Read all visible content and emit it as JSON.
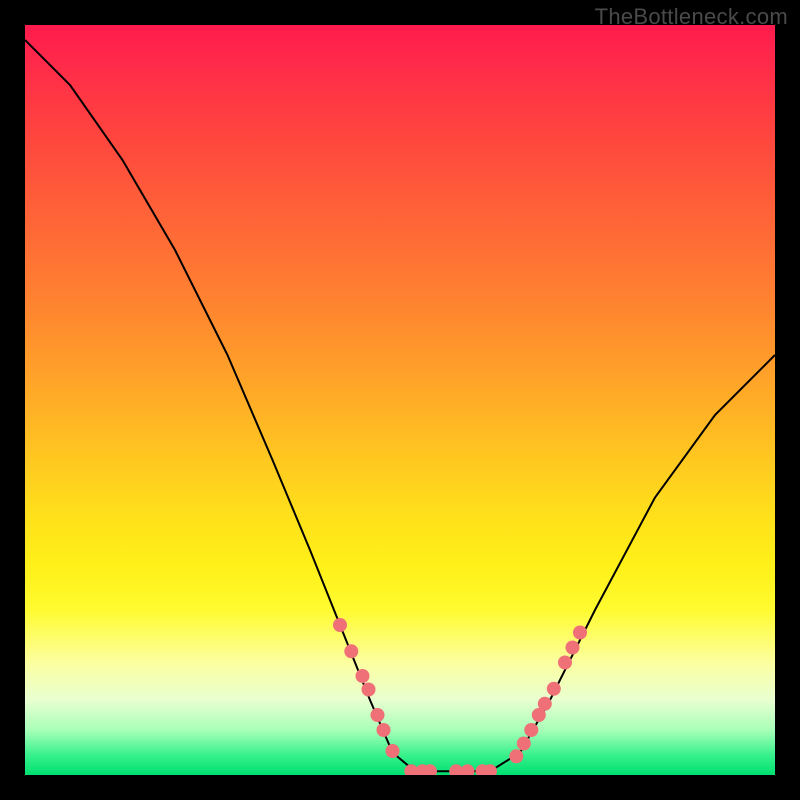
{
  "watermark": "TheBottleneck.com",
  "chart_data": {
    "type": "line",
    "title": "",
    "xlabel": "",
    "ylabel": "",
    "xlim": [
      0,
      100
    ],
    "ylim": [
      0,
      100
    ],
    "curve": [
      {
        "x": 0,
        "y": 98
      },
      {
        "x": 6,
        "y": 92
      },
      {
        "x": 13,
        "y": 82
      },
      {
        "x": 20,
        "y": 70
      },
      {
        "x": 27,
        "y": 56
      },
      {
        "x": 33,
        "y": 42
      },
      {
        "x": 38,
        "y": 30
      },
      {
        "x": 42,
        "y": 20
      },
      {
        "x": 46,
        "y": 10
      },
      {
        "x": 49,
        "y": 3
      },
      {
        "x": 52,
        "y": 0.5
      },
      {
        "x": 58,
        "y": 0.5
      },
      {
        "x": 62,
        "y": 0.5
      },
      {
        "x": 66,
        "y": 3
      },
      {
        "x": 70,
        "y": 10
      },
      {
        "x": 76,
        "y": 22
      },
      {
        "x": 84,
        "y": 37
      },
      {
        "x": 92,
        "y": 48
      },
      {
        "x": 100,
        "y": 56
      }
    ],
    "markers_left": [
      {
        "x": 42.0,
        "y": 20.0
      },
      {
        "x": 43.5,
        "y": 16.5
      },
      {
        "x": 45.0,
        "y": 13.2
      },
      {
        "x": 45.8,
        "y": 11.4
      },
      {
        "x": 47.0,
        "y": 8.0
      },
      {
        "x": 47.8,
        "y": 6.0
      },
      {
        "x": 49.0,
        "y": 3.2
      }
    ],
    "markers_bottom": [
      {
        "x": 51.5,
        "y": 0.5
      },
      {
        "x": 53.0,
        "y": 0.5
      },
      {
        "x": 54.0,
        "y": 0.5
      },
      {
        "x": 57.5,
        "y": 0.5
      },
      {
        "x": 59.0,
        "y": 0.5
      },
      {
        "x": 61.0,
        "y": 0.5
      },
      {
        "x": 62.0,
        "y": 0.5
      }
    ],
    "markers_right": [
      {
        "x": 65.5,
        "y": 2.5
      },
      {
        "x": 66.5,
        "y": 4.2
      },
      {
        "x": 67.5,
        "y": 6.0
      },
      {
        "x": 68.5,
        "y": 8.0
      },
      {
        "x": 69.3,
        "y": 9.5
      },
      {
        "x": 70.5,
        "y": 11.5
      },
      {
        "x": 72.0,
        "y": 15.0
      },
      {
        "x": 73.0,
        "y": 17.0
      },
      {
        "x": 74.0,
        "y": 19.0
      }
    ],
    "marker_color": "#f07078",
    "curve_color": "#000000"
  }
}
